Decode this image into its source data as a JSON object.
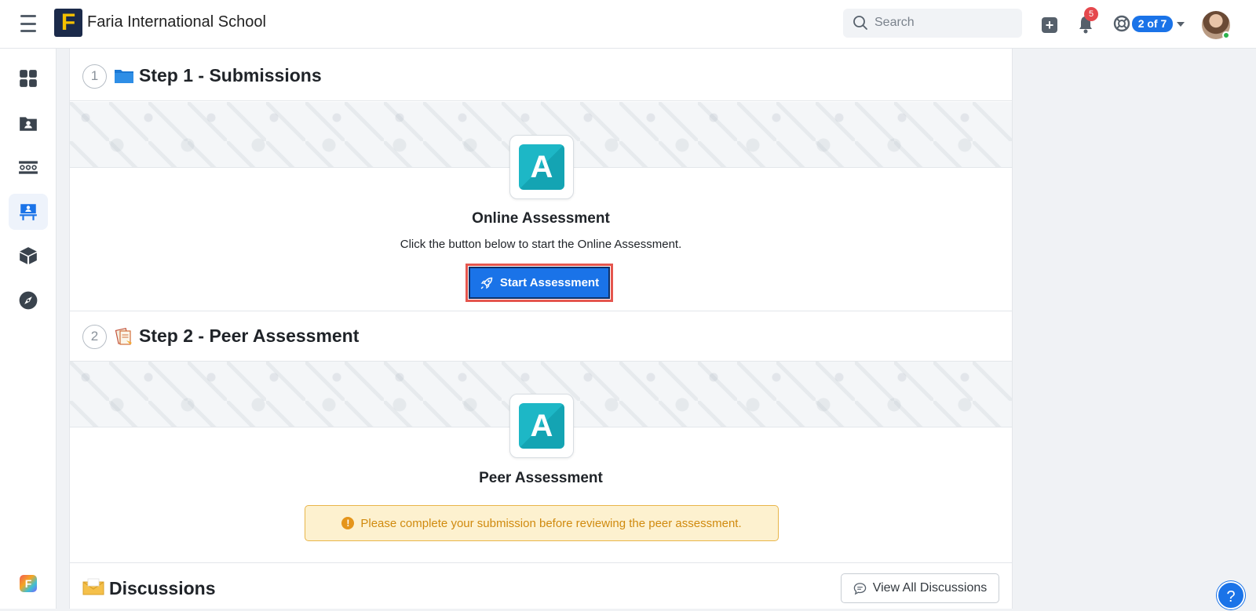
{
  "topbar": {
    "school_name": "Faria International School",
    "logo_letter": "F",
    "search_placeholder": "Search",
    "notifications_count": "5",
    "help_badge": "2 of 7"
  },
  "sidebar": {
    "items": [
      {
        "icon": "dashboard-icon"
      },
      {
        "icon": "student-folder-icon"
      },
      {
        "icon": "classroom-icon"
      },
      {
        "icon": "teacher-board-icon",
        "active": true
      },
      {
        "icon": "box-icon"
      },
      {
        "icon": "compass-icon"
      }
    ],
    "app_icon_letter": "F"
  },
  "step1": {
    "number": "1",
    "title": "Step 1 - Submissions",
    "app_letter": "A",
    "section_title": "Online Assessment",
    "description": "Click the button below to start the Online Assessment.",
    "button_label": "Start Assessment"
  },
  "step2": {
    "number": "2",
    "title": "Step 2 - Peer Assessment",
    "app_letter": "A",
    "section_title": "Peer Assessment",
    "warning": "Please complete your submission before reviewing the peer assessment.",
    "warning_icon": "!"
  },
  "discussions": {
    "title": "Discussions",
    "view_all_label": "View All Discussions"
  },
  "help_button": "?",
  "colors": {
    "accent": "#1a73e8",
    "highlight_outline": "#e5564e",
    "warning_bg": "#fdf1cf",
    "warning_text": "#d08a0e",
    "app_teal": "#1db7c6"
  }
}
